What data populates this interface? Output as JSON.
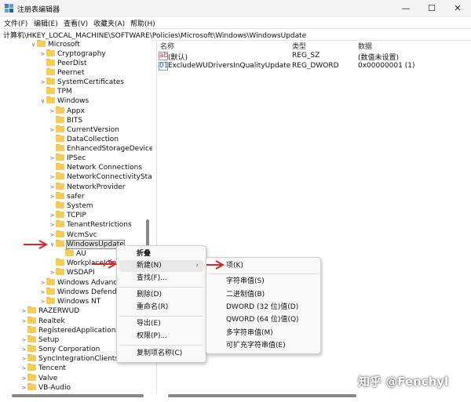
{
  "window": {
    "title": "注册表编辑器",
    "controls": {
      "minimize": "—",
      "maximize": "☐",
      "close": "✕"
    }
  },
  "menubar": [
    "文件(F)",
    "编辑(E)",
    "查看(V)",
    "收藏夹(A)",
    "帮助(H)"
  ],
  "address": "计算机\\HKEY_LOCAL_MACHINE\\SOFTWARE\\Policies\\Microsoft\\Windows\\WindowsUpdate",
  "tree": [
    {
      "label": "Microsoft",
      "chevron": "∨"
    },
    {
      "label": "Cryptography",
      "chevron": ">"
    },
    {
      "label": "PeerDist",
      "chevron": ""
    },
    {
      "label": "Peernet",
      "chevron": ""
    },
    {
      "label": "SystemCertificates",
      "chevron": ">"
    },
    {
      "label": "TPM",
      "chevron": ""
    },
    {
      "label": "Windows",
      "chevron": "∨"
    },
    {
      "label": "Appx",
      "chevron": ">"
    },
    {
      "label": "BITS",
      "chevron": ""
    },
    {
      "label": "CurrentVersion",
      "chevron": ">"
    },
    {
      "label": "DataCollection",
      "chevron": ""
    },
    {
      "label": "EnhancedStorageDevice",
      "chevron": ""
    },
    {
      "label": "IPSec",
      "chevron": ">"
    },
    {
      "label": "Network Connections",
      "chevron": ""
    },
    {
      "label": "NetworkConnectivitySta",
      "chevron": ">"
    },
    {
      "label": "NetworkProvider",
      "chevron": ">"
    },
    {
      "label": "safer",
      "chevron": ">"
    },
    {
      "label": "System",
      "chevron": ""
    },
    {
      "label": "TCPIP",
      "chevron": ">"
    },
    {
      "label": "TenantRestrictions",
      "chevron": ">"
    },
    {
      "label": "WcmSvc",
      "chevron": ">"
    },
    {
      "label": "WindowsUpdate",
      "chevron": "∨"
    },
    {
      "label": "AU",
      "chevron": ""
    },
    {
      "label": "WorkplaceJoin",
      "chevron": ""
    },
    {
      "label": "WSDAPI",
      "chevron": ">"
    },
    {
      "label": "Windows Advance",
      "chevron": ">"
    },
    {
      "label": "Windows Defende",
      "chevron": ">"
    },
    {
      "label": "Windows NT",
      "chevron": ">"
    },
    {
      "label": "RAZERWUD",
      "chevron": ">"
    },
    {
      "label": "Realtek",
      "chevron": ">"
    },
    {
      "label": "RegisteredApplications",
      "chevron": ""
    },
    {
      "label": "Setup",
      "chevron": ">"
    },
    {
      "label": "Sony Corporation",
      "chevron": ">"
    },
    {
      "label": "SyncIntegrationClients",
      "chevron": ">"
    },
    {
      "label": "Tencent",
      "chevron": ">"
    },
    {
      "label": "Valve",
      "chevron": ">"
    },
    {
      "label": "VB-Audio",
      "chevron": ">"
    }
  ],
  "list": {
    "headers": {
      "name": "名称",
      "type": "类型",
      "data": "数据"
    },
    "rows": [
      {
        "icon": "ab",
        "name": "(默认)",
        "type": "REG_SZ",
        "data": "(数值未设置)"
      },
      {
        "icon": "01",
        "name": "ExcludeWUDriversInQualityUpdate",
        "type": "REG_DWORD",
        "data": "0x00000001 (1)"
      }
    ]
  },
  "context_menu": {
    "items": [
      "折叠",
      "新建(N)",
      "查找(F)...",
      "删除(D)",
      "重命名(R)",
      "导出(E)",
      "权限(P)...",
      "复制项名称(C)"
    ],
    "submenu_arrow": "›"
  },
  "submenu": {
    "items": [
      "项(K)",
      "字符串值(S)",
      "二进制值(B)",
      "DWORD (32 位)值(D)",
      "QWORD (64 位)值(Q)",
      "多字符串值(M)",
      "可扩充字符串值(E)"
    ]
  },
  "watermark": "知乎 @Fenchyl",
  "colors": {
    "arrow": "#d9262b",
    "folder": "#f5cc5a"
  }
}
